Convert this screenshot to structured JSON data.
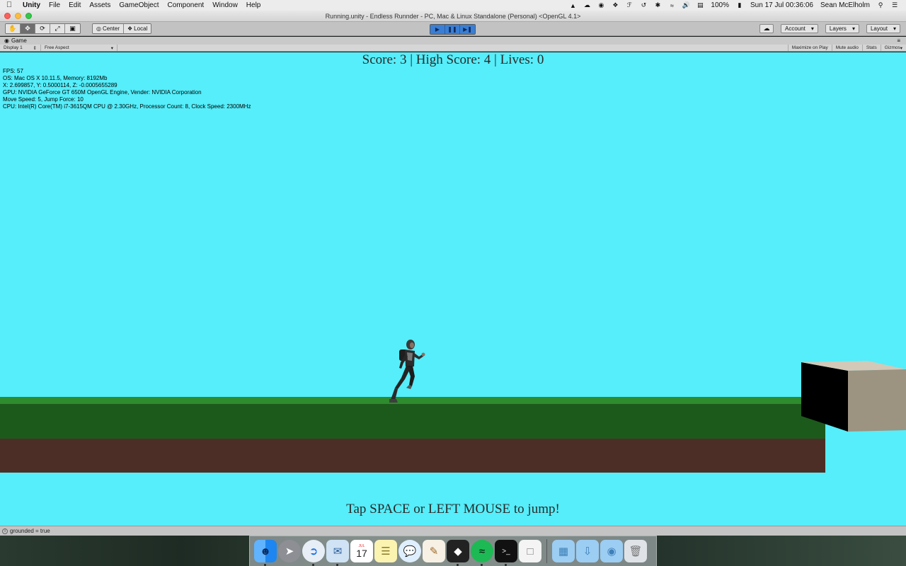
{
  "menubar": {
    "apple_icon": "apple-icon",
    "app_name": "Unity",
    "items": [
      "File",
      "Edit",
      "Assets",
      "GameObject",
      "Component",
      "Window",
      "Help"
    ],
    "battery": "100%",
    "datetime": "Sun 17 Jul  00:36:06",
    "user": "Sean McElholm"
  },
  "window": {
    "title": "Running.unity - Endless Runnder - PC, Mac & Linux Standalone (Personal) <OpenGL 4.1>"
  },
  "toolbar": {
    "pivot_label": "Center",
    "space_label": "Local",
    "account_label": "Account",
    "layers_label": "Layers",
    "layout_label": "Layout"
  },
  "game_view": {
    "tab_label": "Game",
    "display_label": "Display 1",
    "aspect_label": "Free Aspect",
    "maximize_label": "Maximize on Play",
    "mute_label": "Mute audio",
    "stats_label": "Stats",
    "gizmos_label": "Gizmos"
  },
  "hud": {
    "score_text": "Score: 3 | High Score: 4 | Lives: 0",
    "hint_text": "Tap SPACE or LEFT MOUSE to jump!"
  },
  "debug": {
    "lines": [
      "FPS: 57",
      "OS: Mac OS X 10.11.5, Memory: 8192Mb",
      "X: 2.699857, Y: 0.5000114, Z: -0.0005655289",
      "GPU: NVIDIA GeForce GT 650M OpenGL Engine, Vender: NVIDIA Corporation",
      "Move Speed: 5, Jump Force: 10",
      "CPU: Intel(R) Core(TM) i7-3615QM CPU @ 2.30GHz, Processor Count: 8, Clock Speed: 2300MHz"
    ]
  },
  "console": {
    "message": "grounded = true"
  },
  "dock": {
    "apps": [
      "finder",
      "launchpad",
      "safari",
      "mail",
      "calendar",
      "notes",
      "messages",
      "textedit",
      "unity",
      "spotify",
      "terminal",
      "preview",
      "folder",
      "downloads-folder",
      "applications-folder",
      "trash"
    ],
    "calendar_day": "17",
    "calendar_month": "JUL"
  },
  "colors": {
    "sky": "#55eefa",
    "grass": "#1c5a1c",
    "dirt": "#4c2e27",
    "play_accent": "#3a7fd5"
  }
}
